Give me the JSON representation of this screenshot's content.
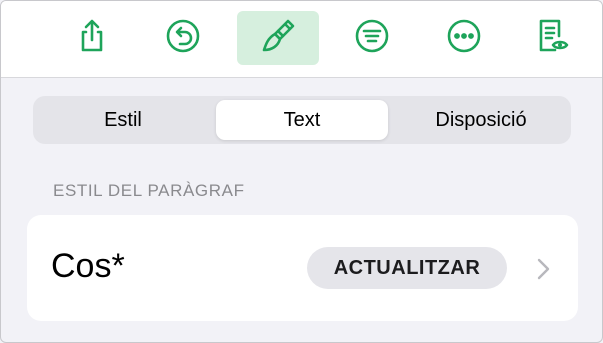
{
  "colors": {
    "accent": "#1ea45a",
    "active_bg": "#d6efde"
  },
  "toolbar": {
    "items": [
      {
        "icon": "share-icon",
        "active": false
      },
      {
        "icon": "undo-icon",
        "active": false
      },
      {
        "icon": "paintbrush-icon",
        "active": true
      },
      {
        "icon": "insert-icon",
        "active": false
      },
      {
        "icon": "more-icon",
        "active": false
      },
      {
        "icon": "reading-view-icon",
        "active": false
      }
    ]
  },
  "tabs": {
    "selected": "Text",
    "items": [
      "Estil",
      "Text",
      "Disposició"
    ]
  },
  "section": {
    "label": "ESTIL DEL PARÀGRAF"
  },
  "paragraph_style": {
    "name": "Cos*",
    "update_label": "ACTUALITZAR",
    "chevron_icon": "chevron-right-icon"
  }
}
